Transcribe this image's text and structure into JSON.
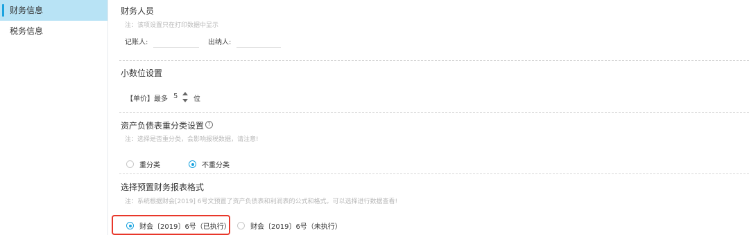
{
  "sidebar": {
    "items": [
      {
        "label": "财务信息",
        "active": true
      },
      {
        "label": "税务信息",
        "active": false
      }
    ]
  },
  "finance_staff": {
    "title": "财务人员",
    "note": "注：该项设置只在打印数据中显示",
    "bookkeeper_label": "记账人:",
    "bookkeeper_value": "",
    "cashier_label": "出纳人:",
    "cashier_value": ""
  },
  "decimal": {
    "title": "小数位设置",
    "unit_price_label": "【单价】最多",
    "value": "5",
    "suffix": "位"
  },
  "balance_sheet": {
    "title": "资产负债表重分类设置",
    "help_icon": "?",
    "note": "注：选择是否重分类，会影响报税数据，请注意!",
    "options": [
      {
        "label": "重分类",
        "selected": false
      },
      {
        "label": "不重分类",
        "selected": true
      }
    ]
  },
  "report_format": {
    "title": "选择预置财务报表格式",
    "note": "注：系统根据财会[2019] 6号文预置了资产负债表和利润表的公式和格式。可以选择进行数据查看!",
    "options": [
      {
        "label": "财会〔2019〕6号（已执行）",
        "selected": true
      },
      {
        "label": "财会〔2019〕6号（未执行）",
        "selected": false
      }
    ]
  },
  "colors": {
    "accent": "#1aa3df",
    "highlight": "#e8372a",
    "active_bg": "#b8e3f5"
  }
}
